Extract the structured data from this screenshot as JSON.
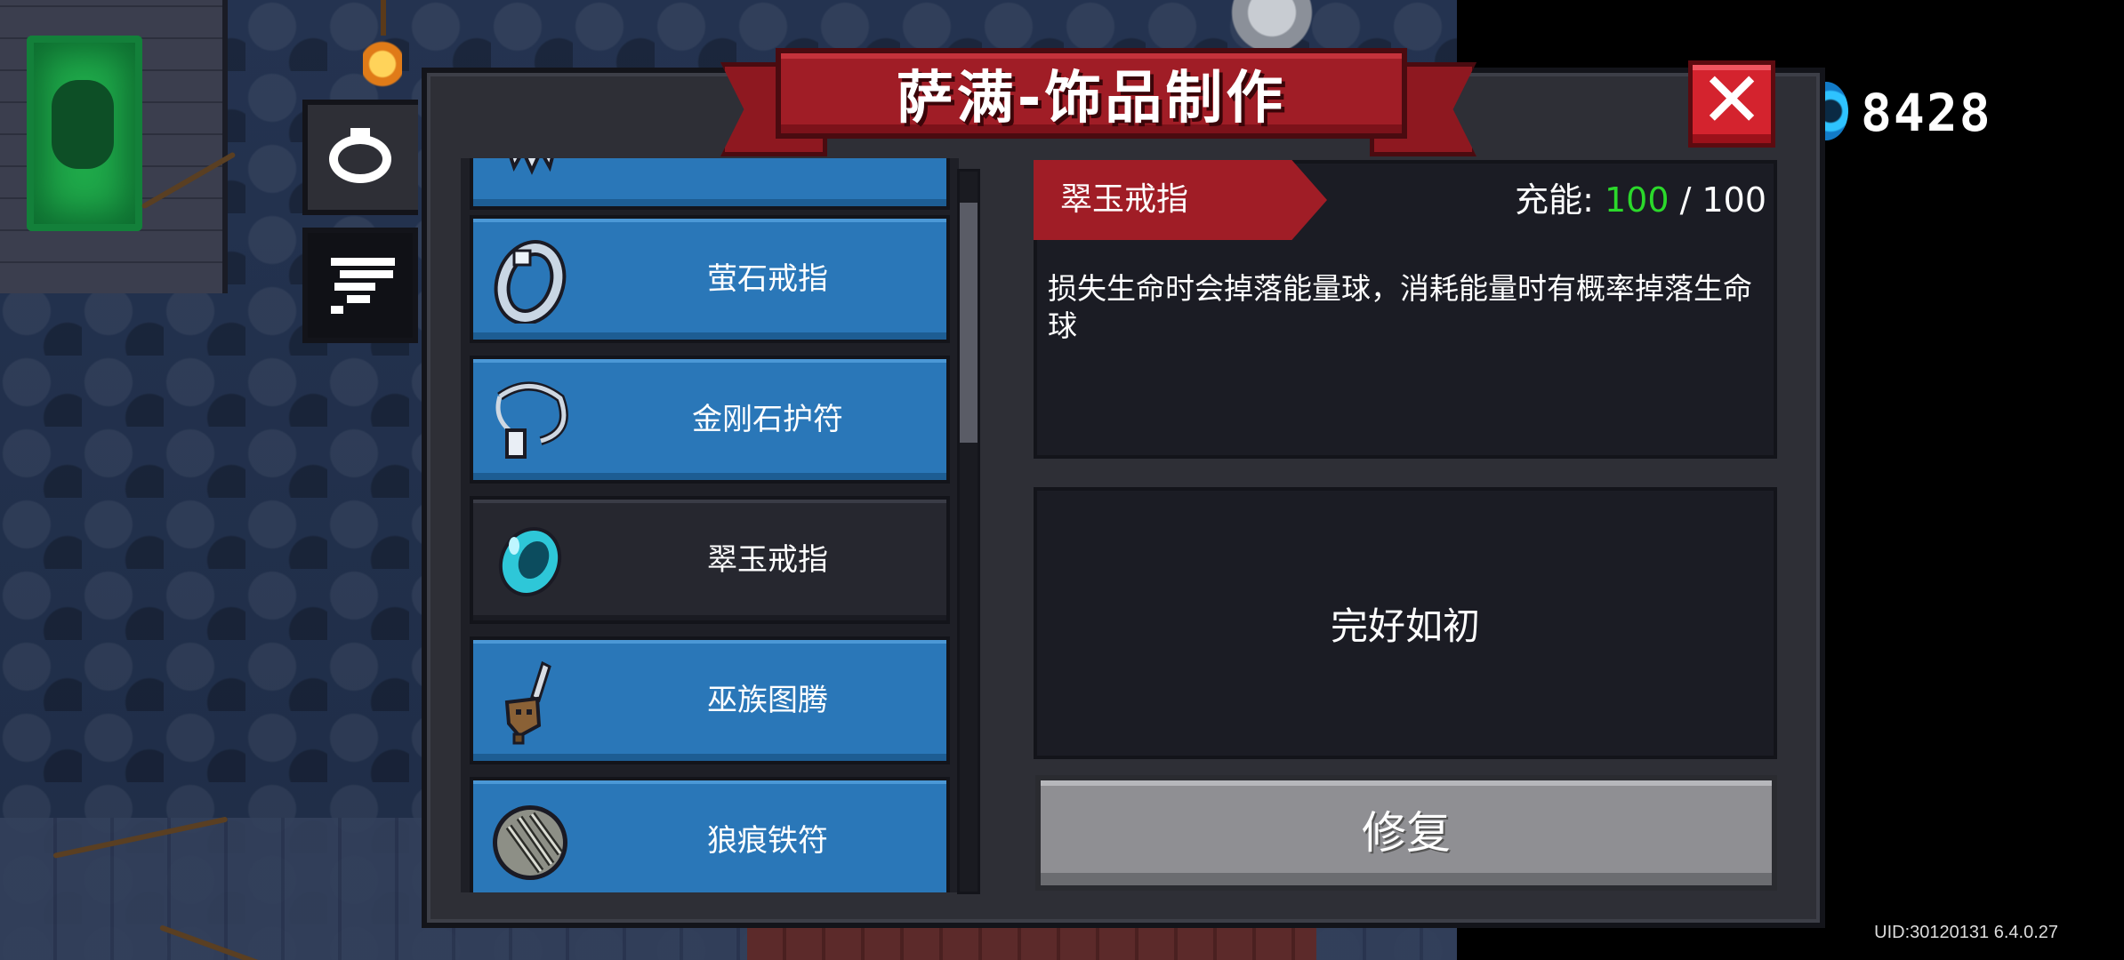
{
  "header": {
    "title": "萨满-饰品制作",
    "close_label": "✕"
  },
  "currency": {
    "icon": "gem-icon",
    "value": "8428"
  },
  "tabs": [
    {
      "name": "accessory-tab",
      "icon": "ring-icon",
      "active": true
    },
    {
      "name": "list-tab",
      "icon": "lines-icon",
      "active": false
    }
  ],
  "items": [
    {
      "label": "",
      "icon": "partial-item-icon"
    },
    {
      "label": "萤石戒指",
      "icon": "fluorite-ring-icon"
    },
    {
      "label": "金刚石护符",
      "icon": "diamond-amulet-icon"
    },
    {
      "label": "翠玉戒指",
      "icon": "jade-ring-icon",
      "selected": true
    },
    {
      "label": "巫族图腾",
      "icon": "witch-totem-icon"
    },
    {
      "label": "狼痕铁符",
      "icon": "wolf-iron-charm-icon"
    }
  ],
  "detail": {
    "name": "翠玉戒指",
    "charge_label": "充能: ",
    "charge_current": "100",
    "charge_max": " / 100",
    "description": "损失生命时会掉落能量球，消耗能量时有概率掉落生命球",
    "status": "完好如初",
    "repair_label": "修复"
  },
  "footer": {
    "uid": "UID:30120131 6.4.0.27"
  },
  "colors": {
    "item_bg": "#2a77b8",
    "banner_red": "#a01d26",
    "charge_green": "#2bd92b",
    "panel_bg": "#2e2f36"
  }
}
